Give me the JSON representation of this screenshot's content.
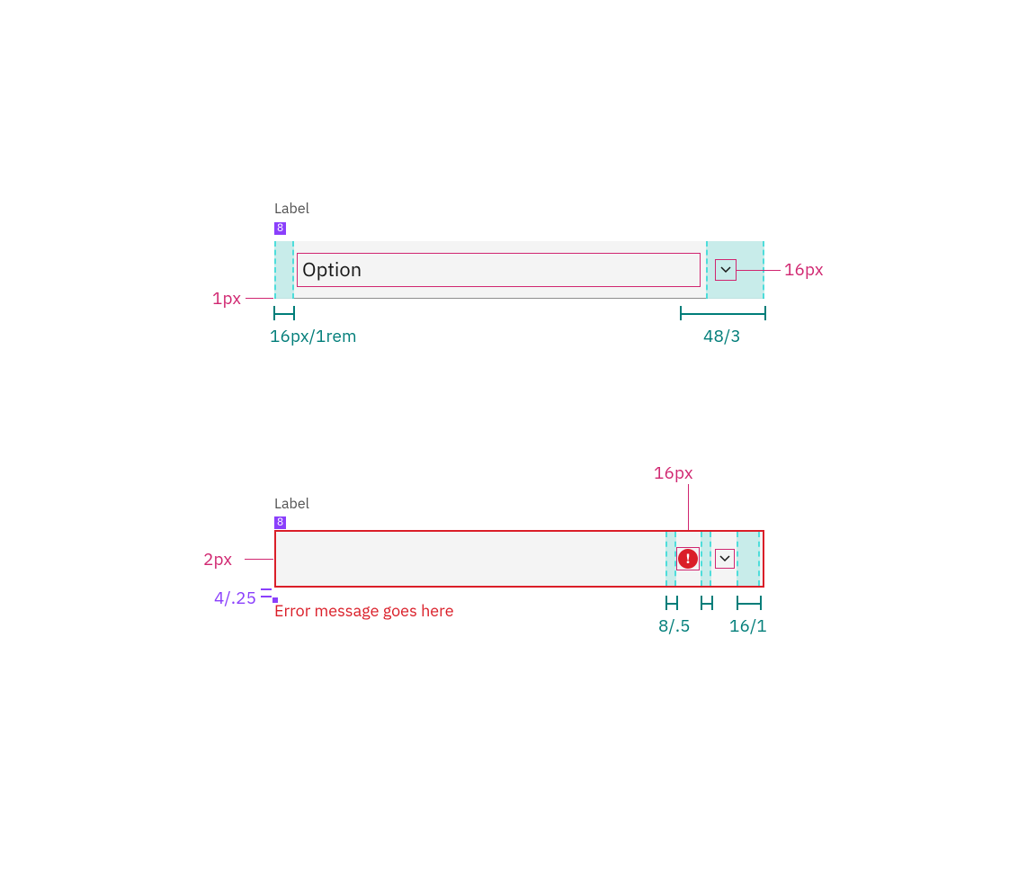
{
  "colors": {
    "teal": "#007d79",
    "magenta": "#d02670",
    "purple": "#8a3ffc",
    "error": "#da1e28",
    "field_bg": "#f4f4f4",
    "teal_highlight": "#c4ece9"
  },
  "spec_default": {
    "label": "Label",
    "label_gap_badge": "8",
    "option_text": "Option",
    "chevron_size": "16px",
    "bottom_border": "1px",
    "left_padding": "16px/1rem",
    "right_hit_area": "48/3"
  },
  "spec_error": {
    "label": "Label",
    "label_gap_badge": "8",
    "icon_size": "16px",
    "border_width": "2px",
    "msg_gap": "4/.25",
    "error_message": "Error message goes here",
    "gap_small": "8/.5",
    "gap_right": "16/1"
  }
}
